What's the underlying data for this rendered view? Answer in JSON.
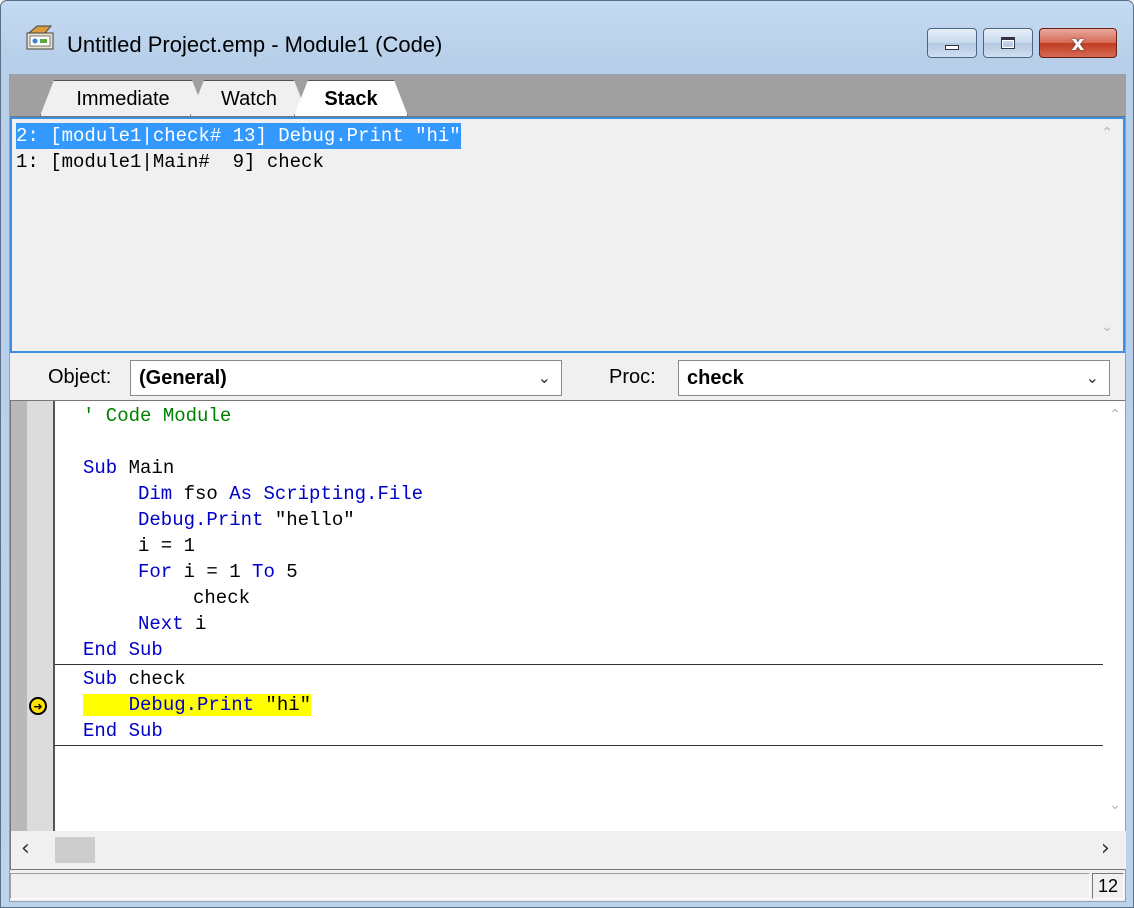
{
  "window": {
    "title": "Untitled Project.emp - Module1 (Code)",
    "icon": "project-icon",
    "buttons": {
      "minimize": "minimize-icon",
      "maximize": "maximize-icon",
      "close": "close-icon"
    },
    "close_glyph": "x"
  },
  "tabs": [
    {
      "label": "Immediate",
      "active": false
    },
    {
      "label": "Watch",
      "active": false
    },
    {
      "label": "Stack",
      "active": true
    }
  ],
  "stack": {
    "lines": [
      {
        "text": "2: [module1|check# 13] Debug.Print \"hi\"",
        "selected": true
      },
      {
        "text": "1: [module1|Main#  9] check",
        "selected": false
      }
    ]
  },
  "selectors": {
    "object_label": "Object:",
    "object_value": "(General)",
    "proc_label": "Proc:",
    "proc_value": "check"
  },
  "code": {
    "l1": "' Code Module",
    "l3_kw": "Sub",
    "l3_rest": " Main",
    "l4_kw1": "Dim",
    "l4_mid": " fso ",
    "l4_kw2": "As Scripting.File",
    "l5_kw": "Debug.Print",
    "l5_rest": " \"hello\"",
    "l6": "i = 1",
    "l7_kw1": "For",
    "l7_mid": " i = 1 ",
    "l7_kw2": "To",
    "l7_end": " 5",
    "l8": "check",
    "l9_kw": "Next",
    "l9_rest": " i",
    "l10": "End Sub",
    "l11_kw": "Sub",
    "l11_rest": " check",
    "l12_kw": "Debug.Print",
    "l12_rest": " \"hi\"",
    "l13": "End Sub"
  },
  "status": {
    "line_number": "12"
  },
  "colors": {
    "keyword": "#0000c8",
    "comment": "#008000",
    "highlight": "#ffff00",
    "selection": "#3399ff"
  }
}
